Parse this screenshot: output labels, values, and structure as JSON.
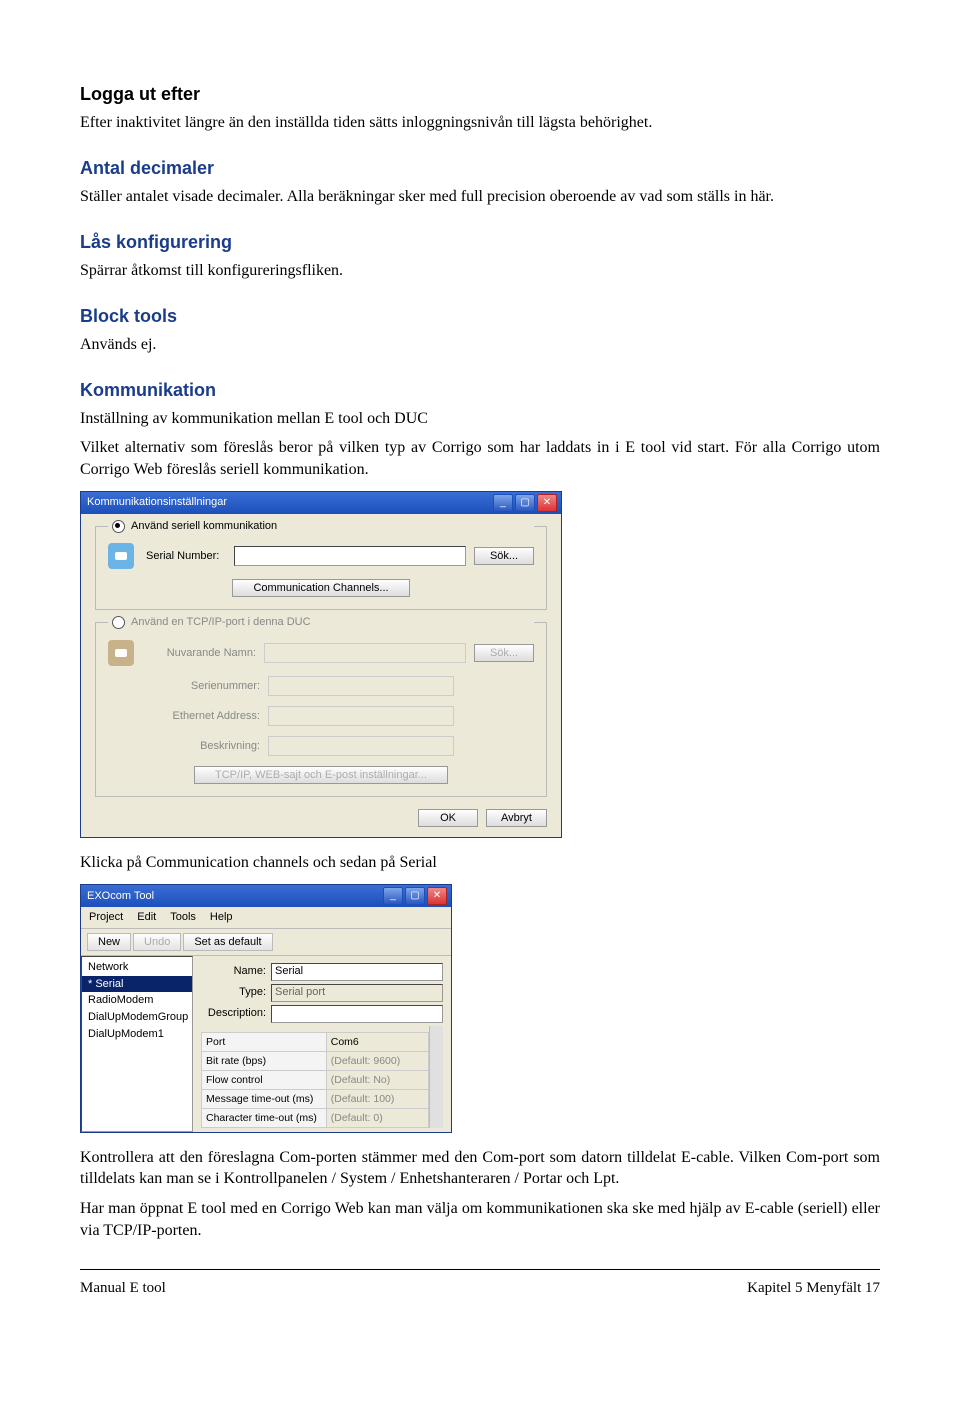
{
  "sections": {
    "s1_title": "Logga ut efter",
    "s1_body": "Efter inaktivitet längre än den inställda tiden sätts inloggningsnivån till lägsta behörighet.",
    "s2_title": "Antal decimaler",
    "s2_body": "Ställer antalet visade decimaler. Alla beräkningar sker med full precision oberoende av vad som ställs in här.",
    "s3_title": "Lås konfigurering",
    "s3_body": "Spärrar åtkomst till konfigureringsfliken.",
    "s4_title": "Block tools",
    "s4_body": "Används ej.",
    "s5_title": "Kommunikation",
    "s5_body1": "Inställning av kommunikation mellan E tool och DUC",
    "s5_body2": "Vilket alternativ som föreslås beror på vilken typ av Corrigo som har laddats in i E tool vid start. För alla Corrigo utom Corrigo Web föreslås seriell kommunikation.",
    "s5_after_img1": "Klicka på Communication channels och sedan på Serial",
    "s5_after_img2a": "Kontrollera att den föreslagna Com-porten stämmer med den Com-port som datorn tilldelat E-cable.",
    "s5_after_img2b": " Vilken Com-port som tilldelats kan man se i Kontrollpanelen / System / Enhetshanteraren / Portar och Lpt.",
    "s5_after_img3": "Har man öppnat E tool med en Corrigo Web kan man välja om kommunikationen ska ske med hjälp av E-cable (seriell) eller via TCP/IP-porten."
  },
  "dialog1": {
    "title": "Kommunikationsinställningar",
    "radio_serial": "Använd seriell kommunikation",
    "serial_label": "Serial Number:",
    "search_btn": "Sök...",
    "comm_channels_btn": "Communication Channels...",
    "radio_tcp": "Använd en TCP/IP-port i denna DUC",
    "tcp_name": "Nuvarande Namn:",
    "tcp_serial": "Serienummer:",
    "tcp_eth": "Ethernet Address:",
    "tcp_desc": "Beskrivning:",
    "tcp_btn": "TCP/IP, WEB-sajt och E-post inställningar...",
    "ok": "OK",
    "cancel": "Avbryt"
  },
  "dialog2": {
    "title": "EXOcom Tool",
    "menu": [
      "Project",
      "Edit",
      "Tools",
      "Help"
    ],
    "toolbar": {
      "new": "New",
      "undo": "Undo",
      "setdefault": "Set as default"
    },
    "list": [
      "Network",
      "* Serial",
      "RadioModem",
      "DialUpModemGroup",
      "DialUpModem1"
    ],
    "selected_index": 1,
    "form": {
      "name_lbl": "Name:",
      "name_val": "Serial",
      "type_lbl": "Type:",
      "type_val": "Serial port",
      "desc_lbl": "Description:"
    },
    "props": [
      {
        "k": "Port",
        "v": "Com6"
      },
      {
        "k": "Bit rate (bps)",
        "v": "(Default: 9600)"
      },
      {
        "k": "Flow control",
        "v": "(Default: No)"
      },
      {
        "k": "Message time-out (ms)",
        "v": "(Default: 100)"
      },
      {
        "k": "Character time-out (ms)",
        "v": "(Default: 0)"
      }
    ]
  },
  "footer": {
    "left": "Manual E tool",
    "right": "Kapitel 5   Menyfält    17"
  }
}
